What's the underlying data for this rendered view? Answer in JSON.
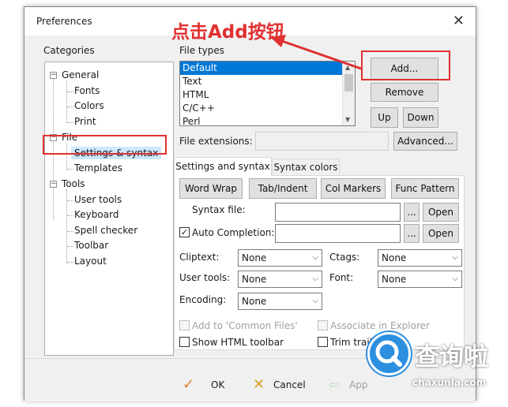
{
  "window": {
    "title": "Preferences"
  },
  "annotation": {
    "text": "点击Add按钮"
  },
  "categories": {
    "label": "Categories",
    "tree": [
      {
        "label": "General",
        "toggle": "−"
      },
      {
        "label": "Fonts"
      },
      {
        "label": "Colors"
      },
      {
        "label": "Print"
      },
      {
        "label": "File",
        "toggle": "−"
      },
      {
        "label": "Settings & syntax"
      },
      {
        "label": "Templates"
      },
      {
        "label": "Tools",
        "toggle": "−"
      },
      {
        "label": "User tools"
      },
      {
        "label": "Keyboard"
      },
      {
        "label": "Spell checker"
      },
      {
        "label": "Toolbar"
      },
      {
        "label": "Layout"
      }
    ]
  },
  "file_types": {
    "label": "File types",
    "items": [
      "Default",
      "Text",
      "HTML",
      "C/C++",
      "Perl"
    ],
    "selected": "Default"
  },
  "buttons": {
    "add": "Add...",
    "remove": "Remove",
    "up": "Up",
    "down": "Down",
    "advanced": "Advanced..."
  },
  "file_extensions": {
    "label": "File extensions:"
  },
  "tabs": [
    "Settings and syntax",
    "Syntax colors"
  ],
  "settings": {
    "word_wrap": "Word Wrap",
    "tab_indent": "Tab/Indent",
    "col_markers": "Col Markers",
    "func_pattern": "Func Pattern",
    "syntax_file_label": "Syntax file:",
    "auto_completion_label": "Auto Completion:",
    "auto_completion_checked": true,
    "browse": "...",
    "open": "Open",
    "cliptext_label": "Cliptext:",
    "cliptext_value": "None",
    "ctags_label": "Ctags:",
    "ctags_value": "None",
    "user_tools_label": "User tools:",
    "user_tools_value": "None",
    "font_label": "Font:",
    "font_value": "None",
    "encoding_label": "Encoding:",
    "encoding_value": "None",
    "add_common_files": "Add to 'Common Files'",
    "associate_explorer": "Associate in Explorer",
    "show_html_toolbar": "Show HTML toolbar",
    "trim_trailing": "Trim traili"
  },
  "footer": {
    "ok": "OK",
    "cancel": "Cancel",
    "apply": "App"
  },
  "watermark": {
    "brand": "查询啦",
    "site": "chaxunla.com"
  }
}
